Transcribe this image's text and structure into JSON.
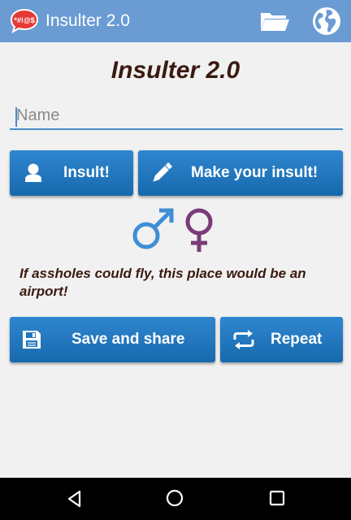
{
  "app_bar": {
    "title": "Insulter 2.0",
    "logo_text": "*#!@$",
    "icons": [
      "app-logo-icon",
      "folder-icon",
      "globe-icon"
    ]
  },
  "main": {
    "heading": "Insulter 2.0",
    "name_placeholder": "Name",
    "insult_button": "Insult!",
    "make_button": "Make your insult!",
    "insult_text": "If assholes could fly, this place would be an airport!",
    "save_button": "Save and share",
    "repeat_button": "Repeat"
  },
  "colors": {
    "app_bar": "#6a9bd3",
    "button": "#1f78c1",
    "male": "#3d8ed6",
    "female": "#7a3b78",
    "text_dark": "#3a1a10"
  },
  "nav": {
    "icons": [
      "back-icon",
      "home-icon",
      "recents-icon"
    ]
  }
}
